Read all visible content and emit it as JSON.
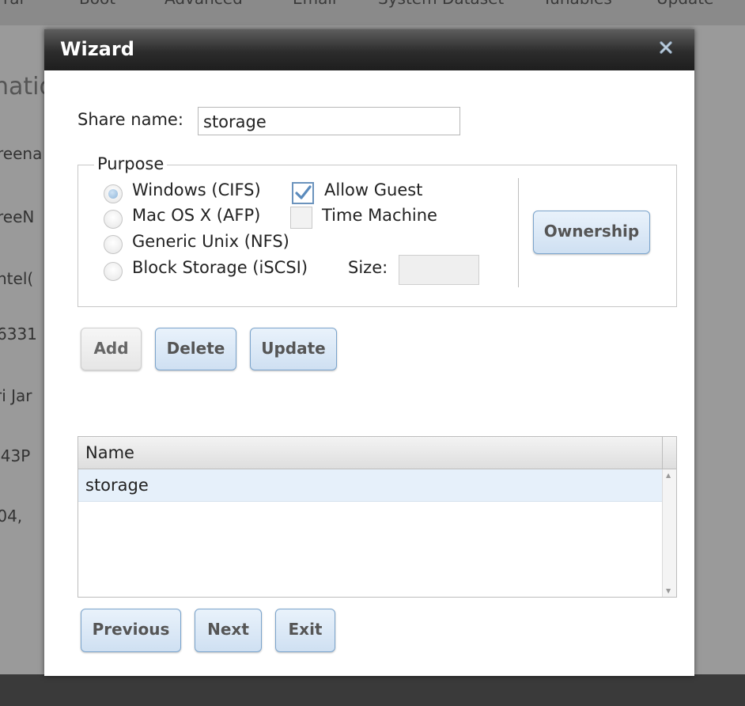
{
  "background": {
    "tabs": [
      "ral",
      "Boot",
      "Advanced",
      "Email",
      "System Dataset",
      "Tunables",
      "Update"
    ],
    "section_heading": "natio",
    "info_lines": [
      "reena",
      "reeN",
      "ntel(",
      "6331",
      "ri Jar",
      ":43P",
      ".04,"
    ]
  },
  "dialog": {
    "title": "Wizard",
    "close_icon": "close-icon",
    "share_name_label": "Share name:",
    "share_name_value": "storage",
    "purpose": {
      "legend": "Purpose",
      "options": [
        {
          "label": "Windows (CIFS)",
          "selected": true
        },
        {
          "label": "Mac OS X (AFP)",
          "selected": false
        },
        {
          "label": "Generic Unix (NFS)",
          "selected": false
        },
        {
          "label": "Block Storage (iSCSI)",
          "selected": false
        }
      ],
      "allow_guest_label": "Allow Guest",
      "allow_guest_checked": true,
      "time_machine_label": "Time Machine",
      "time_machine_checked": false,
      "size_label": "Size:",
      "size_value": "",
      "ownership_button": "Ownership"
    },
    "actions": {
      "add": "Add",
      "delete": "Delete",
      "update": "Update"
    },
    "grid": {
      "column_header": "Name",
      "rows": [
        "storage"
      ]
    },
    "nav": {
      "previous": "Previous",
      "next": "Next",
      "exit": "Exit"
    }
  }
}
